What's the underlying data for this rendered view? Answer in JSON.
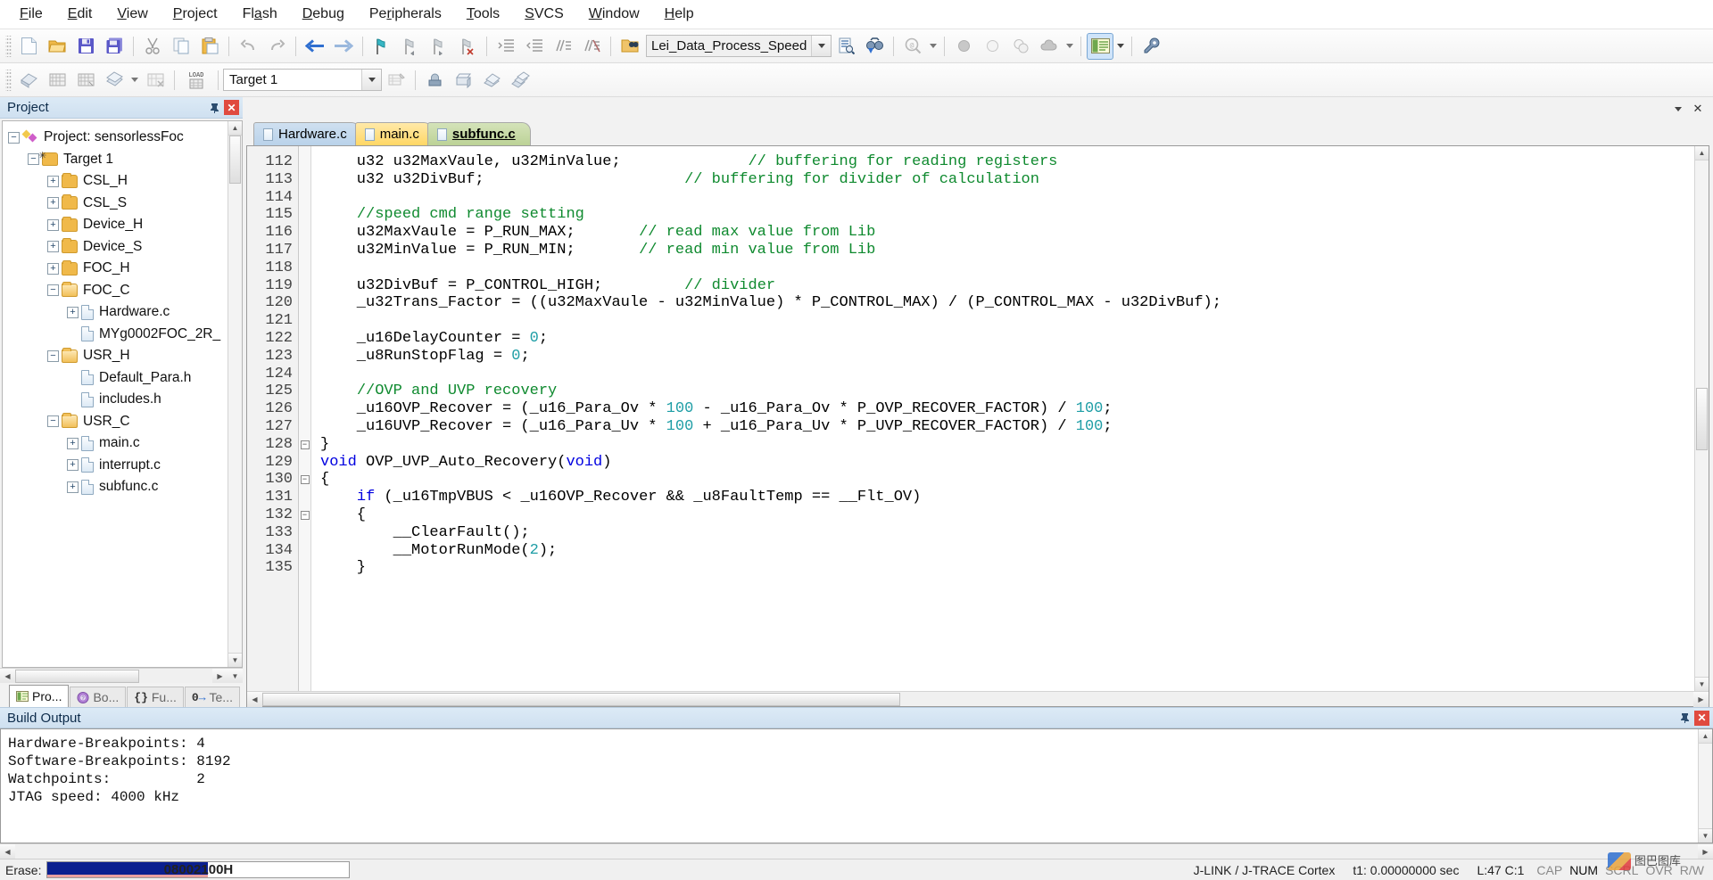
{
  "app": {
    "title": "Keil uVision"
  },
  "menubar": {
    "items": [
      {
        "label": "File",
        "accel": "F"
      },
      {
        "label": "Edit",
        "accel": "E"
      },
      {
        "label": "View",
        "accel": "V"
      },
      {
        "label": "Project",
        "accel": "P"
      },
      {
        "label": "Flash",
        "accel": "a"
      },
      {
        "label": "Debug",
        "accel": "D"
      },
      {
        "label": "Peripherals",
        "accel": "r"
      },
      {
        "label": "Tools",
        "accel": "T"
      },
      {
        "label": "SVCS",
        "accel": "S"
      },
      {
        "label": "Window",
        "accel": "W"
      },
      {
        "label": "Help",
        "accel": "H"
      }
    ]
  },
  "toolbar_main": {
    "combo_value": "Lei_Data_Process_Speed",
    "buttons": [
      {
        "name": "new-file-button",
        "icon": "new-file-icon"
      },
      {
        "name": "open-file-button",
        "icon": "open-folder-icon"
      },
      {
        "name": "save-button",
        "icon": "save-disk-icon"
      },
      {
        "name": "save-all-button",
        "icon": "save-all-icon"
      },
      {
        "name": "cut-button",
        "icon": "scissors-icon"
      },
      {
        "name": "copy-button",
        "icon": "copy-icon"
      },
      {
        "name": "paste-button",
        "icon": "paste-icon"
      },
      {
        "name": "undo-button",
        "icon": "undo-arrow-icon"
      },
      {
        "name": "redo-button",
        "icon": "redo-arrow-icon"
      },
      {
        "name": "navigate-backward-button",
        "icon": "arrow-left-icon"
      },
      {
        "name": "navigate-forward-button",
        "icon": "arrow-right-icon"
      },
      {
        "name": "toggle-bookmark-button",
        "icon": "bookmark-flag-icon"
      },
      {
        "name": "previous-bookmark-button",
        "icon": "bookmark-prev-icon"
      },
      {
        "name": "next-bookmark-button",
        "icon": "bookmark-next-icon"
      },
      {
        "name": "clear-bookmarks-button",
        "icon": "bookmark-clear-icon"
      },
      {
        "name": "indent-button",
        "icon": "indent-right-icon"
      },
      {
        "name": "outdent-button",
        "icon": "indent-left-icon"
      },
      {
        "name": "comment-button",
        "icon": "comment-lines-icon"
      },
      {
        "name": "uncomment-button",
        "icon": "uncomment-lines-icon"
      },
      {
        "name": "open-browse-button",
        "icon": "folder-binoculars-icon"
      },
      {
        "name": "find-in-files-button",
        "icon": "find-in-files-icon"
      },
      {
        "name": "find-button",
        "icon": "binoculars-icon"
      },
      {
        "name": "browse-symbols-button",
        "icon": "magnifier-at-icon"
      },
      {
        "name": "insert-bookmark-gray-button",
        "icon": "gray-circle-icon"
      },
      {
        "name": "disabled-circle-button",
        "icon": "light-circle-icon"
      },
      {
        "name": "two-circles-button",
        "icon": "two-circles-icon"
      },
      {
        "name": "cloud-button",
        "icon": "cloud-icon"
      },
      {
        "name": "project-window-button",
        "icon": "project-window-icon"
      },
      {
        "name": "configuration-wizard-button",
        "icon": "wrench-icon"
      }
    ]
  },
  "toolbar_build": {
    "target_value": "Target 1",
    "buttons": [
      {
        "name": "translate-button",
        "icon": "translate-file-icon"
      },
      {
        "name": "build-button",
        "icon": "build-target-icon"
      },
      {
        "name": "rebuild-button",
        "icon": "rebuild-all-icon"
      },
      {
        "name": "batch-build-button",
        "icon": "batch-build-icon"
      },
      {
        "name": "stop-build-button",
        "icon": "stop-build-icon"
      },
      {
        "name": "download-button",
        "icon": "load-download-icon"
      },
      {
        "name": "manage-project-items-button",
        "icon": "manage-items-icon"
      },
      {
        "name": "target-options-button",
        "icon": "target-options-icon"
      },
      {
        "name": "manage-run-time-env-button",
        "icon": "pack-cube-icon"
      },
      {
        "name": "pack-installer-button",
        "icon": "pack-installer-icon"
      },
      {
        "name": "multi-project-button",
        "icon": "multi-project-icon"
      }
    ]
  },
  "project_panel": {
    "caption": "Project",
    "pin_icon": "pin-icon",
    "close_icon": "close-icon",
    "tree": [
      {
        "label": "Project: sensorlessFoc",
        "indent": 0,
        "expander": "minus",
        "icon": "project-icon"
      },
      {
        "label": "Target 1",
        "indent": 1,
        "expander": "minus",
        "icon": "target-folder-icon"
      },
      {
        "label": "CSL_H",
        "indent": 2,
        "expander": "plus",
        "icon": "folder-icon"
      },
      {
        "label": "CSL_S",
        "indent": 2,
        "expander": "plus",
        "icon": "folder-icon"
      },
      {
        "label": "Device_H",
        "indent": 2,
        "expander": "plus",
        "icon": "folder-icon"
      },
      {
        "label": "Device_S",
        "indent": 2,
        "expander": "plus",
        "icon": "folder-icon"
      },
      {
        "label": "FOC_H",
        "indent": 2,
        "expander": "plus",
        "icon": "folder-icon"
      },
      {
        "label": "FOC_C",
        "indent": 2,
        "expander": "minus",
        "icon": "folder-open-icon"
      },
      {
        "label": "Hardware.c",
        "indent": 3,
        "expander": "plus",
        "icon": "c-file-icon"
      },
      {
        "label": "MYg0002FOC_2R_",
        "indent": 3,
        "expander": "none",
        "icon": "c-file-icon"
      },
      {
        "label": "USR_H",
        "indent": 2,
        "expander": "minus",
        "icon": "folder-open-icon"
      },
      {
        "label": "Default_Para.h",
        "indent": 3,
        "expander": "none",
        "icon": "h-file-icon"
      },
      {
        "label": "includes.h",
        "indent": 3,
        "expander": "none",
        "icon": "h-file-icon"
      },
      {
        "label": "USR_C",
        "indent": 2,
        "expander": "minus",
        "icon": "folder-open-icon"
      },
      {
        "label": "main.c",
        "indent": 3,
        "expander": "plus",
        "icon": "c-file-icon"
      },
      {
        "label": "interrupt.c",
        "indent": 3,
        "expander": "plus",
        "icon": "c-file-icon"
      },
      {
        "label": "subfunc.c",
        "indent": 3,
        "expander": "plus",
        "icon": "c-file-icon"
      }
    ],
    "tabs": [
      {
        "label": "Pro...",
        "icon": "project-window-icon",
        "active": true
      },
      {
        "label": "Bo...",
        "icon": "books-icon",
        "active": false
      },
      {
        "label": "Fu...",
        "icon": "functions-braces-icon",
        "active": false
      },
      {
        "label": "Te...",
        "icon": "templates-icon",
        "active": false
      }
    ]
  },
  "editor": {
    "window_buttons": [
      {
        "name": "editor-dropdown-button",
        "glyph": "▼"
      },
      {
        "name": "editor-close-button",
        "glyph": "✕"
      }
    ],
    "tabs": [
      {
        "label": "Hardware.c",
        "active": false
      },
      {
        "label": "main.c",
        "active": false
      },
      {
        "label": "subfunc.c",
        "active": true
      }
    ],
    "first_line": 112,
    "lines": [
      {
        "n": 112,
        "fold": "",
        "segments": [
          {
            "t": "    u32 u32MaxVaule, u32MinValue;              ",
            "c": "plain"
          },
          {
            "t": "// buffering for reading registers",
            "c": "cmt"
          }
        ]
      },
      {
        "n": 113,
        "fold": "",
        "segments": [
          {
            "t": "    u32 u32DivBuf;                      ",
            "c": "plain"
          },
          {
            "t": "// buffering for divider of calculation",
            "c": "cmt"
          }
        ]
      },
      {
        "n": 114,
        "fold": "",
        "segments": [
          {
            "t": "",
            "c": "plain"
          }
        ]
      },
      {
        "n": 115,
        "fold": "",
        "segments": [
          {
            "t": "    ",
            "c": "plain"
          },
          {
            "t": "//speed cmd range setting",
            "c": "cmt"
          }
        ]
      },
      {
        "n": 116,
        "fold": "",
        "segments": [
          {
            "t": "    u32MaxVaule = P_RUN_MAX;       ",
            "c": "plain"
          },
          {
            "t": "// read max value from Lib",
            "c": "cmt"
          }
        ]
      },
      {
        "n": 117,
        "fold": "",
        "segments": [
          {
            "t": "    u32MinValue = P_RUN_MIN;       ",
            "c": "plain"
          },
          {
            "t": "// read min value from Lib",
            "c": "cmt"
          }
        ]
      },
      {
        "n": 118,
        "fold": "",
        "segments": [
          {
            "t": "",
            "c": "plain"
          }
        ]
      },
      {
        "n": 119,
        "fold": "",
        "segments": [
          {
            "t": "    u32DivBuf = P_CONTROL_HIGH;         ",
            "c": "plain"
          },
          {
            "t": "// divider",
            "c": "cmt"
          }
        ]
      },
      {
        "n": 120,
        "fold": "",
        "segments": [
          {
            "t": "    _u32Trans_Factor = ((u32MaxVaule - u32MinValue) * P_CONTROL_MAX) / (P_CONTROL_MAX - u32DivBuf);",
            "c": "plain"
          }
        ]
      },
      {
        "n": 121,
        "fold": "",
        "segments": [
          {
            "t": "",
            "c": "plain"
          }
        ]
      },
      {
        "n": 122,
        "fold": "",
        "segments": [
          {
            "t": "    _u16DelayCounter = ",
            "c": "plain"
          },
          {
            "t": "0",
            "c": "num"
          },
          {
            "t": ";",
            "c": "plain"
          }
        ]
      },
      {
        "n": 123,
        "fold": "",
        "segments": [
          {
            "t": "    _u8RunStopFlag = ",
            "c": "plain"
          },
          {
            "t": "0",
            "c": "num"
          },
          {
            "t": ";",
            "c": "plain"
          }
        ]
      },
      {
        "n": 124,
        "fold": "",
        "segments": [
          {
            "t": "",
            "c": "plain"
          }
        ]
      },
      {
        "n": 125,
        "fold": "",
        "segments": [
          {
            "t": "    ",
            "c": "plain"
          },
          {
            "t": "//OVP and UVP recovery",
            "c": "cmt"
          }
        ]
      },
      {
        "n": 126,
        "fold": "",
        "segments": [
          {
            "t": "    _u16OVP_Recover = (_u16_Para_Ov * ",
            "c": "plain"
          },
          {
            "t": "100",
            "c": "num"
          },
          {
            "t": " - _u16_Para_Ov * P_OVP_RECOVER_FACTOR) / ",
            "c": "plain"
          },
          {
            "t": "100",
            "c": "num"
          },
          {
            "t": ";",
            "c": "plain"
          }
        ]
      },
      {
        "n": 127,
        "fold": "",
        "segments": [
          {
            "t": "    _u16UVP_Recover = (_u16_Para_Uv * ",
            "c": "plain"
          },
          {
            "t": "100",
            "c": "num"
          },
          {
            "t": " + _u16_Para_Uv * P_UVP_RECOVER_FACTOR) / ",
            "c": "plain"
          },
          {
            "t": "100",
            "c": "num"
          },
          {
            "t": ";",
            "c": "plain"
          }
        ]
      },
      {
        "n": 128,
        "fold": "minus",
        "segments": [
          {
            "t": "}",
            "c": "plain"
          }
        ]
      },
      {
        "n": 129,
        "fold": "",
        "segments": [
          {
            "t": "void",
            "c": "kw"
          },
          {
            "t": " OVP_UVP_Auto_Recovery(",
            "c": "plain"
          },
          {
            "t": "void",
            "c": "kw"
          },
          {
            "t": ")",
            "c": "plain"
          }
        ]
      },
      {
        "n": 130,
        "fold": "minus",
        "segments": [
          {
            "t": "{",
            "c": "plain"
          }
        ]
      },
      {
        "n": 131,
        "fold": "",
        "segments": [
          {
            "t": "    ",
            "c": "plain"
          },
          {
            "t": "if",
            "c": "kw"
          },
          {
            "t": " (_u16TmpVBUS < _u16OVP_Recover && _u8FaultTemp == __Flt_OV)",
            "c": "plain"
          }
        ]
      },
      {
        "n": 132,
        "fold": "minus",
        "segments": [
          {
            "t": "    {",
            "c": "plain"
          }
        ]
      },
      {
        "n": 133,
        "fold": "",
        "segments": [
          {
            "t": "        __ClearFault();",
            "c": "plain"
          }
        ]
      },
      {
        "n": 134,
        "fold": "",
        "segments": [
          {
            "t": "        __MotorRunMode(",
            "c": "plain"
          },
          {
            "t": "2",
            "c": "num"
          },
          {
            "t": ");",
            "c": "plain"
          }
        ]
      },
      {
        "n": 135,
        "fold": "",
        "segments": [
          {
            "t": "    }",
            "c": "plain"
          }
        ]
      }
    ]
  },
  "build_output": {
    "caption": "Build Output",
    "pin_icon": "pin-icon",
    "close_icon": "close-icon",
    "text": "Hardware-Breakpoints: 4\nSoftware-Breakpoints: 8192\nWatchpoints:          2\nJTAG speed: 4000 kHz"
  },
  "statusbar": {
    "label": "Erase:",
    "progress_text": "08002100H",
    "progress_percent": 53,
    "debugger": "J-LINK / J-TRACE Cortex",
    "time": "t1: 0.00000000 sec",
    "cursor": "L:47 C:1",
    "indicators": [
      {
        "label": "CAP",
        "on": false
      },
      {
        "label": "NUM",
        "on": true
      },
      {
        "label": "SCRL",
        "on": false
      },
      {
        "label": "OVR",
        "on": false
      },
      {
        "label": "R/W",
        "on": false
      }
    ],
    "watermark": "图巴图库"
  },
  "colors": {
    "accent": "#cfe0f0",
    "comment_green": "#0f8a2f",
    "keyword_blue": "#0000e0",
    "number_teal": "#1f9ea6",
    "progress_blue": "#0a1f8f",
    "tab_hardware": "#b9d2ea",
    "tab_main": "#ffd765",
    "tab_subfunc": "#bcd297"
  }
}
